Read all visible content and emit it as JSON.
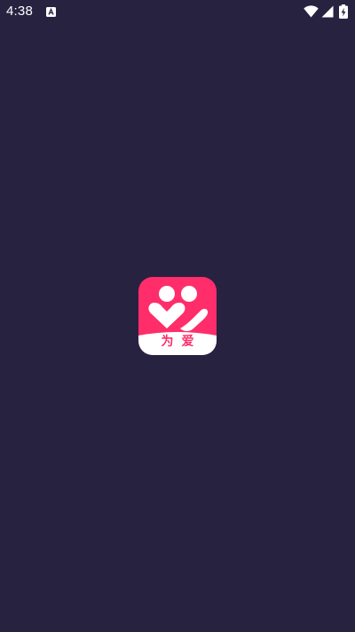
{
  "status_bar": {
    "time": "4:38",
    "notification_icon": "accessibility-a-icon",
    "wifi_icon": "wifi-icon",
    "signal_icon": "cellular-signal-icon",
    "battery_icon": "battery-charging-icon"
  },
  "splash": {
    "logo_icon": "couple-heart-icon",
    "logo_text": "为爱"
  },
  "colors": {
    "background": "#282241",
    "logo_pink": "#FF2D6A",
    "logo_white": "#FFFFFF",
    "status_icons": "#FFFFFF"
  }
}
